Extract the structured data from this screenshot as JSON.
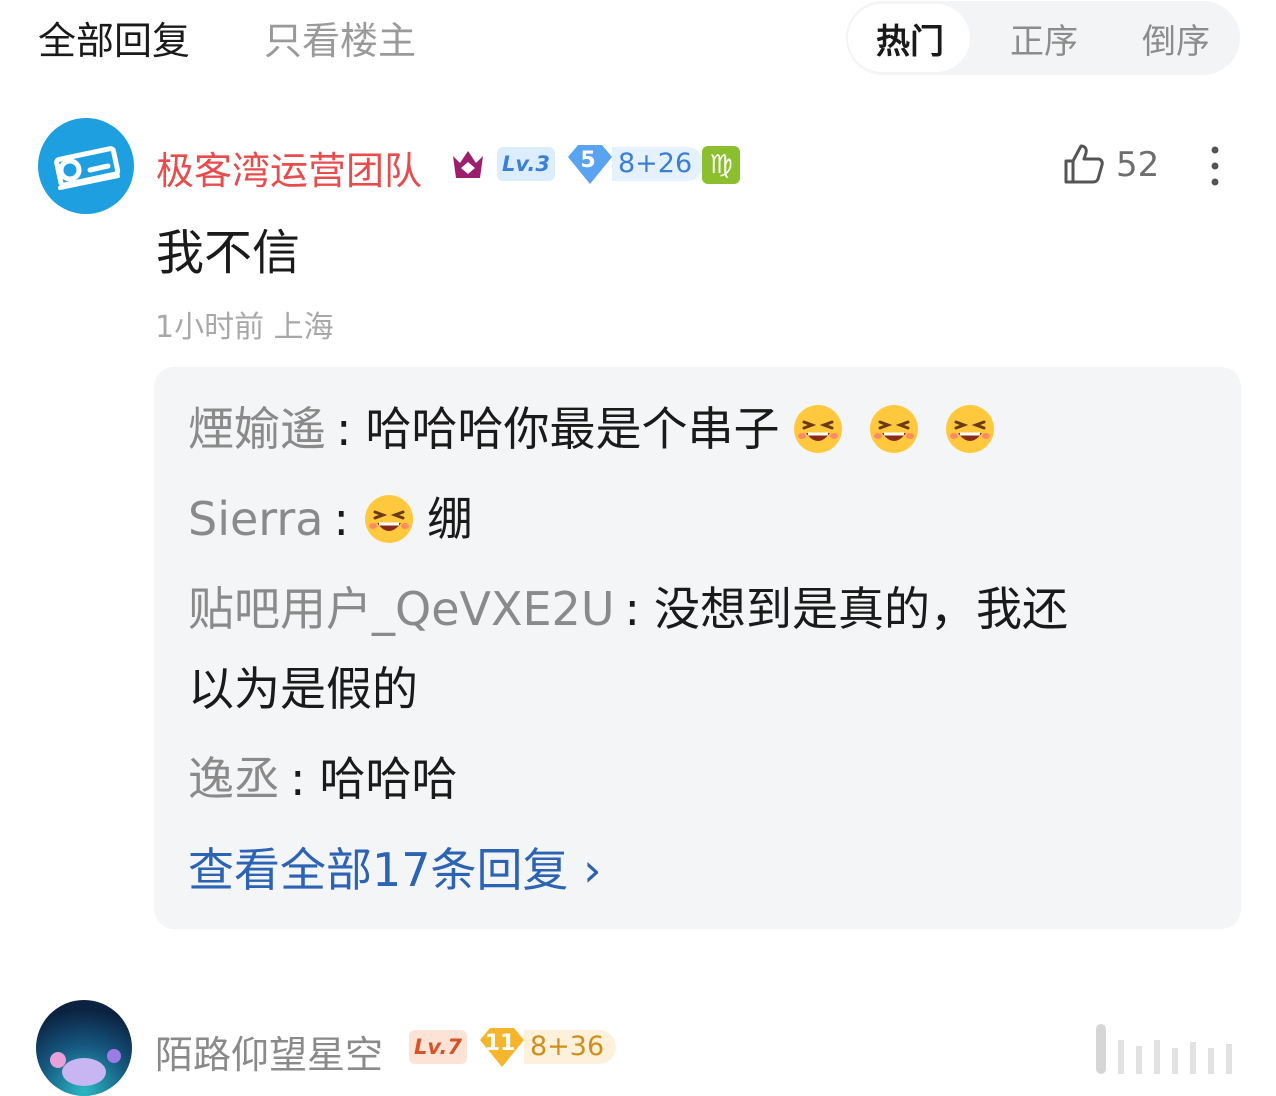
{
  "tabs": {
    "all_replies": "全部回复",
    "owner_only": "只看楼主"
  },
  "sort": {
    "hot": "热门",
    "ascending": "正序",
    "descending": "倒序"
  },
  "post": {
    "username": "极客湾运营团队",
    "level": "Lv.3",
    "gem_level": "5",
    "score": "8+26",
    "zodiac": "♍",
    "like_count": "52",
    "body": "我不信",
    "meta": "1小时前 上海",
    "colors": {
      "username": "#e84c4c",
      "level_badge": "#dceefe",
      "score": "#3a7fd6"
    }
  },
  "replies": [
    {
      "user": "煙媮遙",
      "colon": ":",
      "text": "哈哈哈你最是个串子",
      "emojis": [
        "grin-emoji",
        "grin-emoji",
        "grin-emoji"
      ]
    },
    {
      "user": "Sierra",
      "colon": ":",
      "text": "绷",
      "emojis": [
        "grin-emoji"
      ]
    },
    {
      "user": "贴吧用户_QeVXE2U",
      "colon": ":",
      "text": "没想到是真的，我还",
      "text_line2": "以为是假的"
    },
    {
      "user": "逸丞",
      "colon": ":",
      "text": "哈哈哈"
    }
  ],
  "view_all": "查看全部17条回复 ›",
  "post2": {
    "username": "陌路仰望星空",
    "level": "Lv.7",
    "gem_level": "11",
    "score": "8+36"
  }
}
